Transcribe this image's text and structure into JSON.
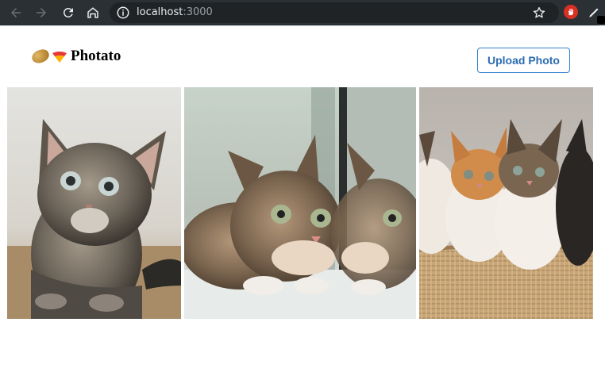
{
  "browser": {
    "url_host": "localhost",
    "url_port": ":3000"
  },
  "header": {
    "brand_emojis": [
      "potato-icon",
      "tato-icon"
    ],
    "brand_name": "Photato",
    "upload_label": "Upload Photo",
    "accent": "#3182ce"
  },
  "gallery": {
    "photos": [
      {
        "name": "photo-kitten-tabby-sitting",
        "alt": "Tabby kitten sitting"
      },
      {
        "name": "photo-kitten-mirror",
        "alt": "Kitten looking at its reflection in a mirror"
      },
      {
        "name": "photo-two-kittens-basket",
        "alt": "Two kittens in a basket"
      }
    ]
  }
}
